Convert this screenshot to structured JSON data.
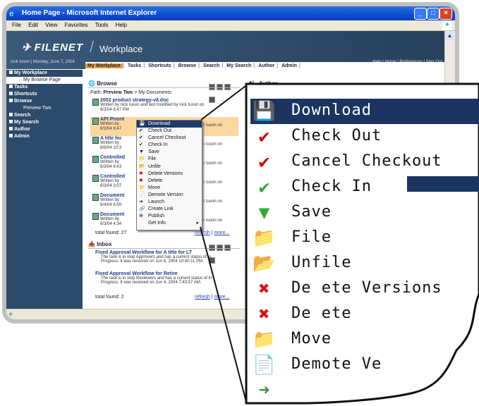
{
  "window": {
    "title": "Home Page - Microsoft Internet Explorer"
  },
  "menu": [
    "File",
    "Edit",
    "View",
    "Favorites",
    "Tools",
    "Help"
  ],
  "banner": {
    "brand": "FILENET",
    "product": "Workplace",
    "user_line": "nick tuson | Monday, June 7, 2004",
    "top_links": "Help | Home | Preferences | Sign Out"
  },
  "nav": {
    "tabs": [
      "My Workplace",
      "Tasks",
      "Shortcuts",
      "Browse",
      "Search",
      "My Search",
      "Author",
      "Admin"
    ]
  },
  "sidebar": {
    "items": [
      {
        "label": "My Workplace",
        "level": 0
      },
      {
        "label": "My Browse Page",
        "level": 1,
        "selected": true
      },
      {
        "label": "Tasks",
        "level": 0
      },
      {
        "label": "Shortcuts",
        "level": 0
      },
      {
        "label": "Browse",
        "level": 0
      },
      {
        "label": "Preview Two",
        "level": 1
      },
      {
        "label": "Search",
        "level": 0
      },
      {
        "label": "My Search",
        "level": 0
      },
      {
        "label": "Author",
        "level": 0
      },
      {
        "label": "Admin",
        "level": 0
      }
    ]
  },
  "browse": {
    "title": "Browse",
    "path_prefix": "Path:",
    "path_bold": "Preview Two",
    "path_rest": "> My Documents",
    "items": [
      {
        "name": "2002 product strategy-v8.doc",
        "line1": "Written by nick tuson and last modified by nick tuson on",
        "line2": "6/3/04 8:47 PM"
      },
      {
        "name": "API Priorit",
        "line1": "Written by",
        "line2": "6/3/04 8:47",
        "tail": "ick tuson on"
      },
      {
        "name": "A title for",
        "line1": "Written by",
        "line2": "6/6/04 10:3",
        "tail": "ick tuson on"
      },
      {
        "name": "Controlled",
        "line1": "Written by",
        "line2": "6/3/04 8:43",
        "tail": "ick tuson on"
      },
      {
        "name": "Controlled",
        "line1": "Written by",
        "line2": "6/3/04 3:07",
        "tail": "ick tuson on"
      },
      {
        "name": "Document",
        "line1": "Written by",
        "line2": "6/4/04 8:59",
        "tail": "ick tuson on"
      },
      {
        "name": "Document",
        "line1": "Written by",
        "line2": "6/3/04 4:34",
        "tail": "ick tuson on"
      }
    ],
    "total": "total found: 27",
    "refresh": "refresh",
    "more": "more..."
  },
  "author": {
    "title": "Author"
  },
  "inbox": {
    "title": "Inbox",
    "items": [
      {
        "name": "Fixed Approval Workflow for A title for LT",
        "line1": "The task is in step Approvers and has a current status of In",
        "line2": "Progress. It was received on Jun 6, 2004 10:40:11 PM."
      },
      {
        "name": "Fixed Approval Workflow for Retire",
        "line1": "The task is in step Reviewers and has a current status of In",
        "line2": "Progress. It was received on Jun 4, 2004 7:43:57 AM."
      }
    ],
    "total": "total found: 2",
    "refresh": "refresh",
    "more": "more..."
  },
  "context_menu": {
    "items": [
      {
        "label": "Download",
        "icon": "download-icon",
        "selected": true
      },
      {
        "label": "Check Out",
        "icon": "check-out-icon"
      },
      {
        "label": "Cancel Checkout",
        "icon": "cancel-checkout-icon"
      },
      {
        "label": "Check In",
        "icon": "check-in-icon"
      },
      {
        "label": "Save",
        "icon": "save-icon"
      },
      {
        "label": "File",
        "icon": "file-icon"
      },
      {
        "label": "Unfile",
        "icon": "unfile-icon"
      },
      {
        "label": "Delete Versions",
        "icon": "delete-versions-icon"
      },
      {
        "label": "Delete",
        "icon": "delete-icon"
      },
      {
        "label": "Move",
        "icon": "move-icon"
      },
      {
        "label": "Demote Version",
        "icon": "demote-version-icon"
      },
      {
        "label": "Launch",
        "icon": "launch-icon"
      },
      {
        "label": "Create Link",
        "icon": "create-link-icon"
      },
      {
        "label": "Publish",
        "icon": "publish-icon"
      },
      {
        "label": "Get Info",
        "icon": "",
        "submenu": true
      }
    ]
  },
  "zoom_menu": {
    "items": [
      {
        "label": "Download",
        "icon": "download-icon",
        "selected": true
      },
      {
        "label": "Check Out",
        "icon": "check-out-icon"
      },
      {
        "label": "Cancel Checkout",
        "icon": "cancel-checkout-icon"
      },
      {
        "label": "Check In",
        "icon": "check-in-icon"
      },
      {
        "label": "Save",
        "icon": "save-icon"
      },
      {
        "label": "File",
        "icon": "file-icon"
      },
      {
        "label": "Unfile",
        "icon": "unfile-icon"
      },
      {
        "label": "De ete Versions",
        "icon": "delete-versions-icon"
      },
      {
        "label": "De ete",
        "icon": "delete-icon"
      },
      {
        "label": "Move",
        "icon": "move-icon"
      },
      {
        "label": "Demote Ve",
        "icon": "demote-version-icon"
      }
    ]
  },
  "colors": {
    "titlebar": "#0a4ed0",
    "banner": "#2c4a6a",
    "nav_active": "#e7a23a",
    "selection": "#1b3560",
    "highlight_row": "#fbd7a0"
  }
}
